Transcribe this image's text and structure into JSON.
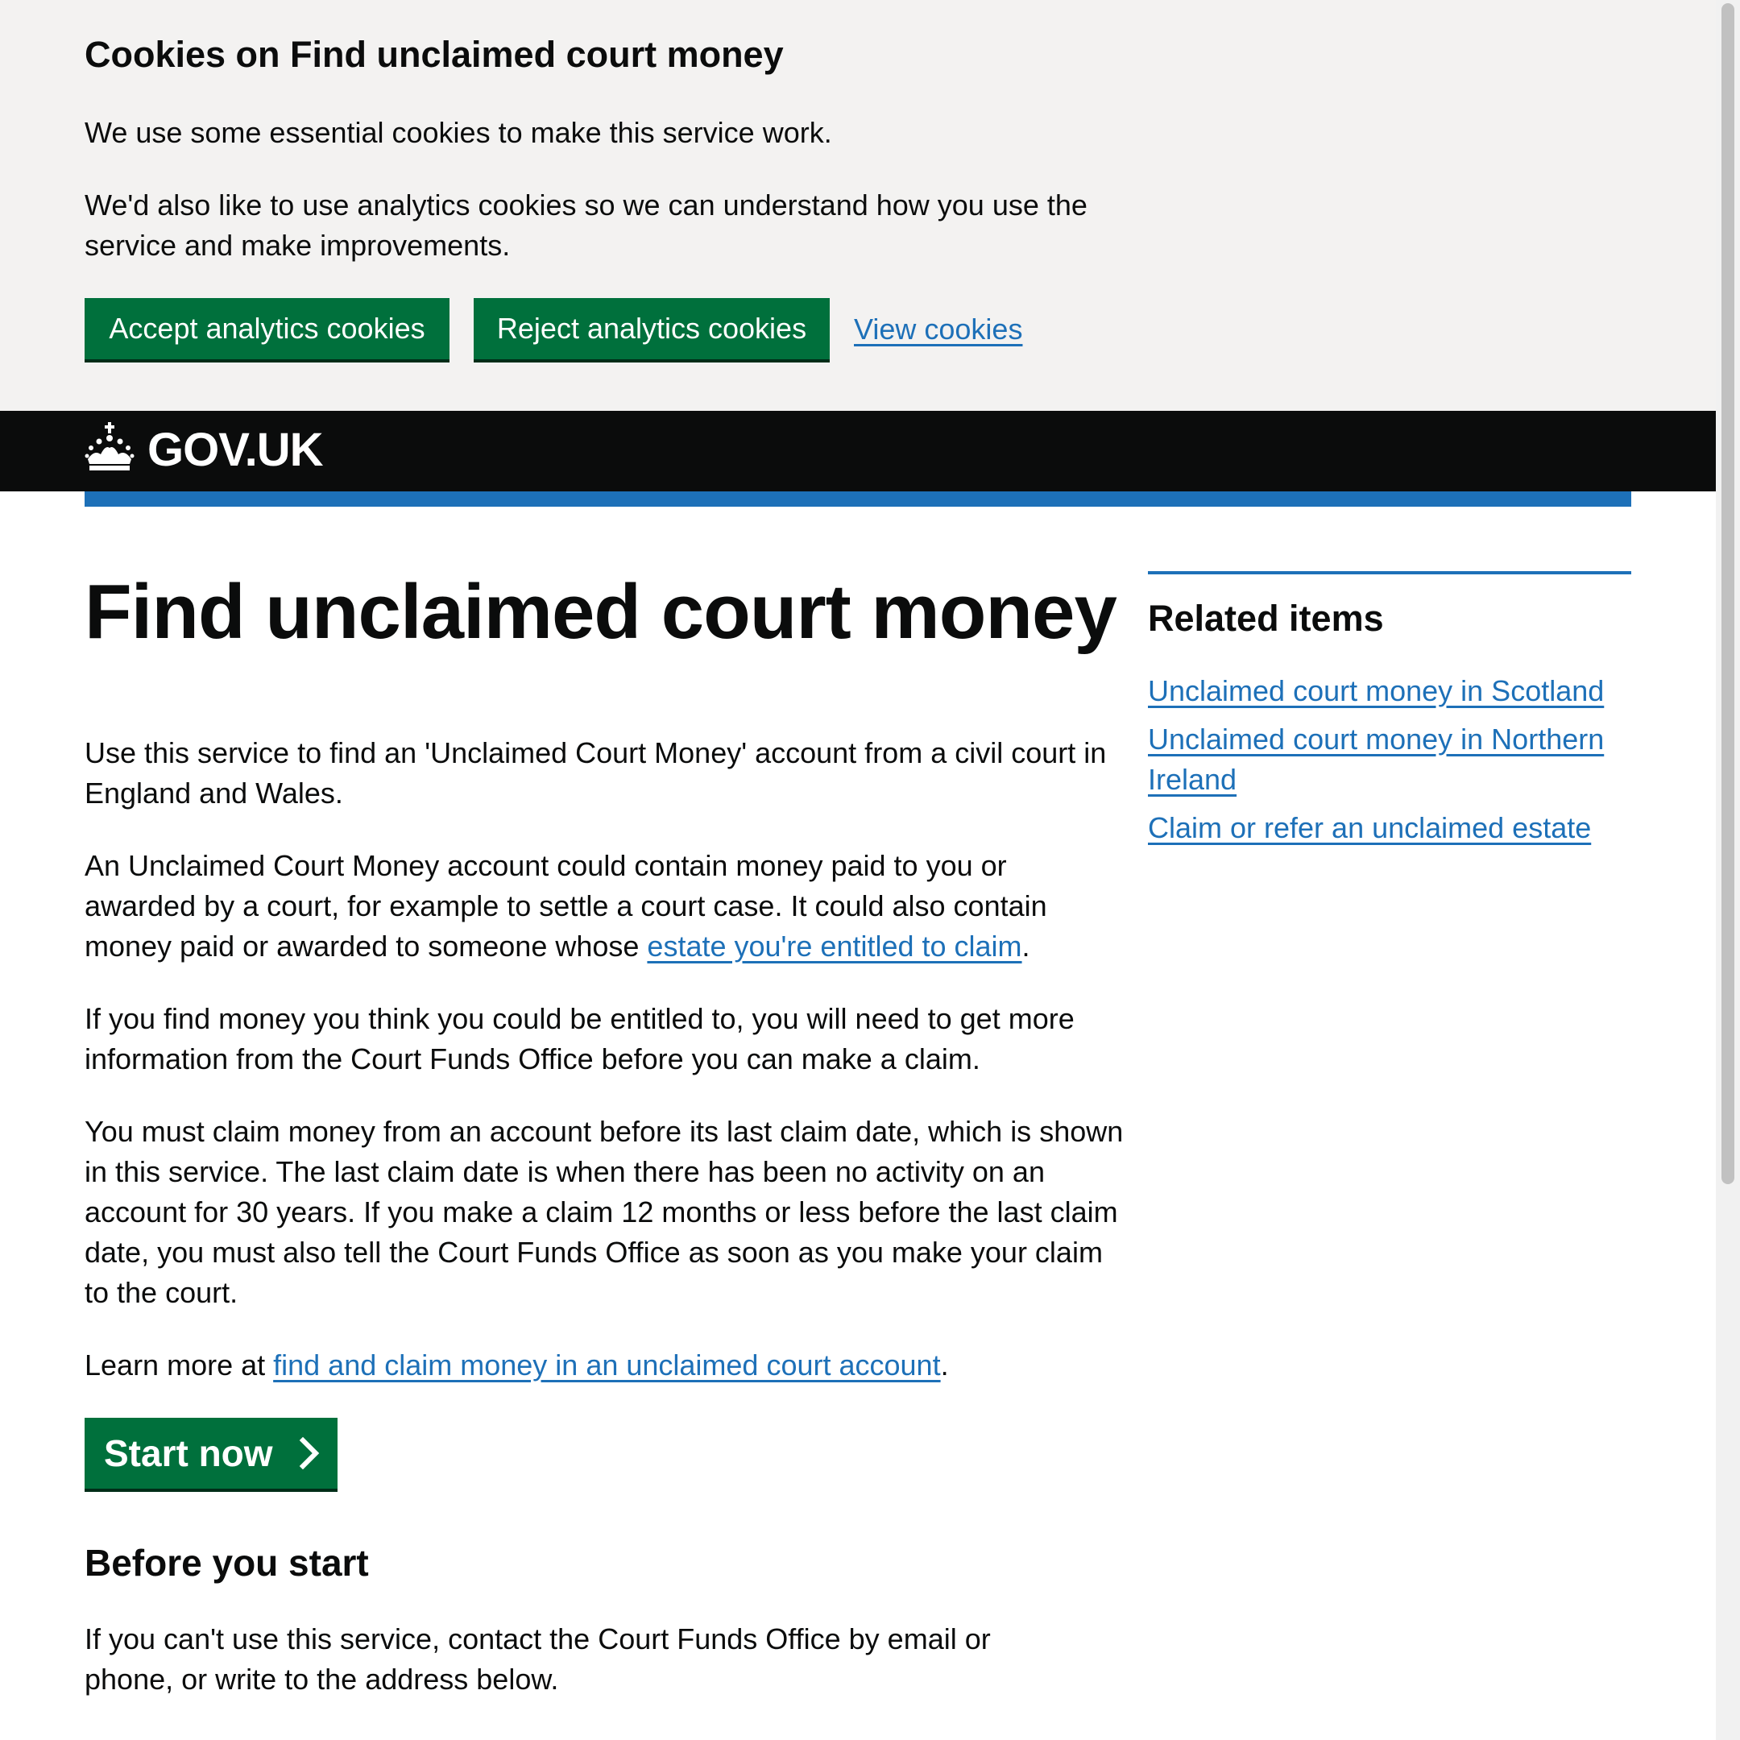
{
  "cookie_banner": {
    "title": "Cookies on Find unclaimed court money",
    "text_essential": "We use some essential cookies to make this service work.",
    "text_analytics": "We'd also like to use analytics cookies so we can understand how you use the service and make improvements.",
    "accept_label": "Accept analytics cookies",
    "reject_label": "Reject analytics cookies",
    "view_label": "View cookies"
  },
  "header": {
    "logo_text": "GOV.UK",
    "crown_icon": "crown-icon"
  },
  "main": {
    "title": "Find unclaimed court money",
    "intro": "Use this service to find an 'Unclaimed Court Money' account from a civil court in England and Wales.",
    "account_before": "An Unclaimed Court Money account could contain money paid to you or awarded by a court, for example to settle a court case. It could also contain money paid or awarded to someone whose ",
    "account_link": "estate you're entitled to claim",
    "account_after": ".",
    "find_money": "If you find money you think you could be entitled to, you will need to get more information from the Court Funds Office before you can make a claim.",
    "claim_deadline": "You must claim money from an account before its last claim date, which is shown in this service. The last claim date is when there has been no activity on an account for 30 years. If you make a claim 12 months or less before the last claim date, you must also tell the Court Funds Office as soon as you make your claim to the court.",
    "learn_before": "Learn more at ",
    "learn_link": "find and claim money in an unclaimed court account",
    "learn_after": ".",
    "start_label": "Start now",
    "before_title": "Before you start",
    "before_text": "If you can't use this service, contact the Court Funds Office by email or phone, or write to the address below."
  },
  "sidebar": {
    "title": "Related items",
    "items": [
      {
        "label": "Unclaimed court money in Scotland"
      },
      {
        "label": "Unclaimed court money in Northern Ireland"
      },
      {
        "label": "Claim or refer an unclaimed estate"
      }
    ]
  },
  "colors": {
    "button_green": "#00703c",
    "link_blue": "#1d70b8",
    "header_black": "#0b0c0c",
    "banner_grey": "#f3f2f1"
  }
}
